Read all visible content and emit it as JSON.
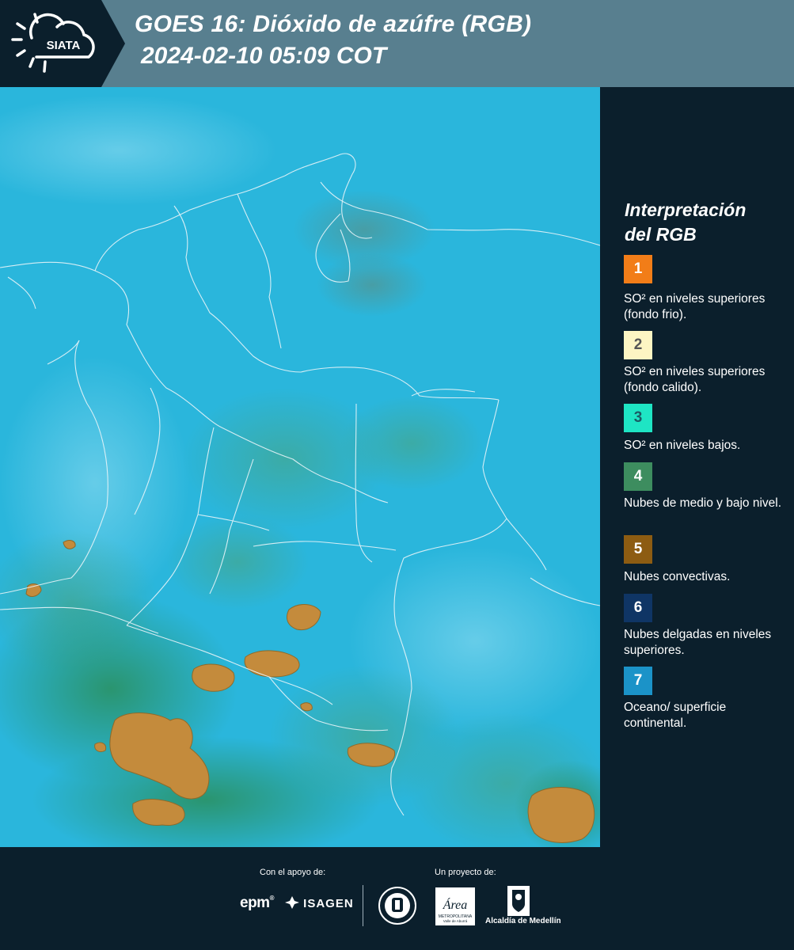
{
  "header": {
    "logo_text": "SIATA",
    "title_line1": "GOES 16: Dióxido de azúfre (RGB)",
    "title_line2": "2024-02-10 05:09 COT"
  },
  "legend": {
    "title_line1": "Interpretación",
    "title_line2": "del RGB",
    "items": [
      {
        "number": "1",
        "color": "#f27d18",
        "text_color": "#ffffff",
        "label": "SO² en niveles superiores (fondo frio)."
      },
      {
        "number": "2",
        "color": "#fdf5c3",
        "text_color": "#555555",
        "label": "SO² en niveles superiores (fondo calido)."
      },
      {
        "number": "3",
        "color": "#1ee5c4",
        "text_color": "#1b5a64",
        "label": "SO² en niveles bajos."
      },
      {
        "number": "4",
        "color": "#3d8d5f",
        "text_color": "#ffffff",
        "label": "Nubes de medio y bajo nivel."
      },
      {
        "number": "5",
        "color": "#8d5c12",
        "text_color": "#ffffff",
        "label": "Nubes convectivas."
      },
      {
        "number": "6",
        "color": "#0f3565",
        "text_color": "#ffffff",
        "label": "Nubes delgadas en niveles superiores."
      },
      {
        "number": "7",
        "color": "#1b93c8",
        "text_color": "#ffffff",
        "label": "Oceano/ superficie continental."
      }
    ]
  },
  "footer": {
    "support_label": "Con el apoyo de:",
    "project_label": "Un proyecto de:",
    "sponsor_epm": "epm",
    "sponsor_isagen": "ISAGEN",
    "area_logo_text": "Área",
    "area_subtitle_line1": "METROPOLITANA",
    "area_subtitle_line2": "Valle de Aburrá",
    "alcaldia_label": "Alcaldía de Medellín"
  },
  "colors": {
    "header_bg": "#587f8f",
    "panel_bg": "#0b1f2c",
    "map_background": "#28b5da",
    "convective_cloud": "#c48b3c"
  }
}
